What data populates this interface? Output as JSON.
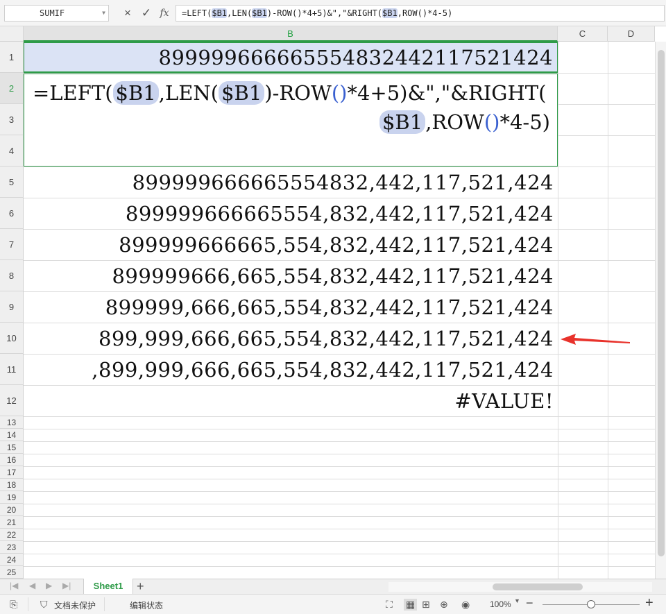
{
  "name_box": {
    "value": "SUMIF"
  },
  "formula_bar": {
    "cancel_icon": "×",
    "confirm_icon": "✓",
    "fx_label": "fx",
    "formula_parts": [
      "=LEFT(",
      "$B1",
      ",LEN(",
      "$B1",
      ")-ROW()*4+5)&\",\"&RIGHT(",
      "$B1",
      ",ROW()*4-5)"
    ]
  },
  "columns": [
    "B",
    "C",
    "D"
  ],
  "rows": [
    "1",
    "2",
    "3",
    "4",
    "5",
    "6",
    "7",
    "8",
    "9",
    "10",
    "11",
    "12",
    "13",
    "14",
    "15",
    "16",
    "17",
    "18",
    "19",
    "20",
    "21",
    "22",
    "23",
    "24",
    "25"
  ],
  "cells": {
    "b1": "899999666665554832442117521424",
    "b5": "899999666665554832,442,117,521,424",
    "b6": "899999666665554,832,442,117,521,424",
    "b7": "899999666665,554,832,442,117,521,424",
    "b8": "899999666,665,554,832,442,117,521,424",
    "b9": "899999,666,665,554,832,442,117,521,424",
    "b10": "899,999,666,665,554,832,442,117,521,424",
    "b11": ",899,999,666,665,554,832,442,117,521,424",
    "b12": "#VALUE!"
  },
  "edit_cell": {
    "line1": [
      "=LEFT(",
      "$B1",
      ",LEN(",
      "$B1",
      ")-ROW",
      "()",
      "*4+5)&\",\"&RIGHT("
    ],
    "line2": [
      "$B1",
      ",ROW",
      "()",
      "*4-5)"
    ]
  },
  "sheet_tabs": {
    "active": "Sheet1",
    "add": "+"
  },
  "status_bar": {
    "protect": "文档未保护",
    "edit_state": "编辑状态",
    "zoom": "100%",
    "zoom_out": "−",
    "zoom_in": "+"
  },
  "colors": {
    "accent": "#2e9b48",
    "ref_highlight": "#c9d3ee",
    "selection": "#dbe3f5",
    "annotation_arrow": "#e8322b"
  }
}
